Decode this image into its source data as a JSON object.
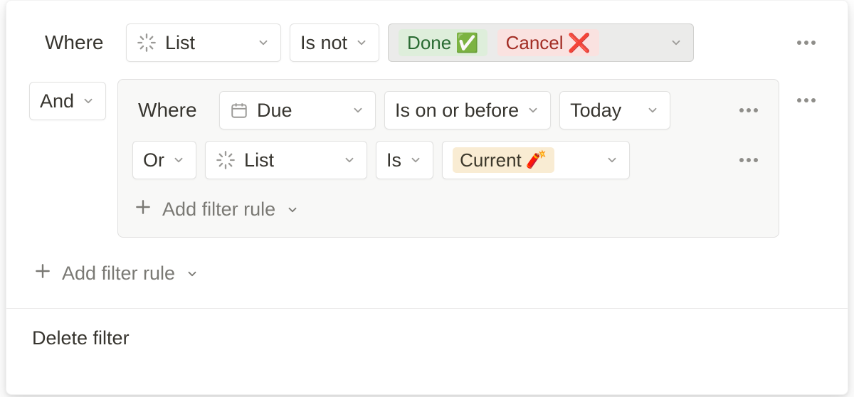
{
  "rule1": {
    "connector_label": "Where",
    "property": {
      "label": "List",
      "icon_name": "spinner-icon"
    },
    "operator": "Is not",
    "values": [
      {
        "label": "Done",
        "emoji": "✅",
        "tag_color": "green"
      },
      {
        "label": "Cancel",
        "emoji": "❌",
        "tag_color": "red"
      }
    ]
  },
  "group": {
    "connector_label": "And",
    "rules": [
      {
        "connector_label": "Where",
        "property": {
          "label": "Due",
          "icon_name": "calendar-icon"
        },
        "operator": "Is on or before",
        "value": {
          "label": "Today"
        }
      },
      {
        "connector_label": "Or",
        "property": {
          "label": "List",
          "icon_name": "spinner-icon"
        },
        "operator": "Is",
        "value": {
          "label": "Current",
          "emoji": "🧨",
          "tag_color": "yellow"
        }
      }
    ],
    "add_rule_label": "Add filter rule"
  },
  "outer_add_rule_label": "Add filter rule",
  "delete_filter_label": "Delete filter"
}
